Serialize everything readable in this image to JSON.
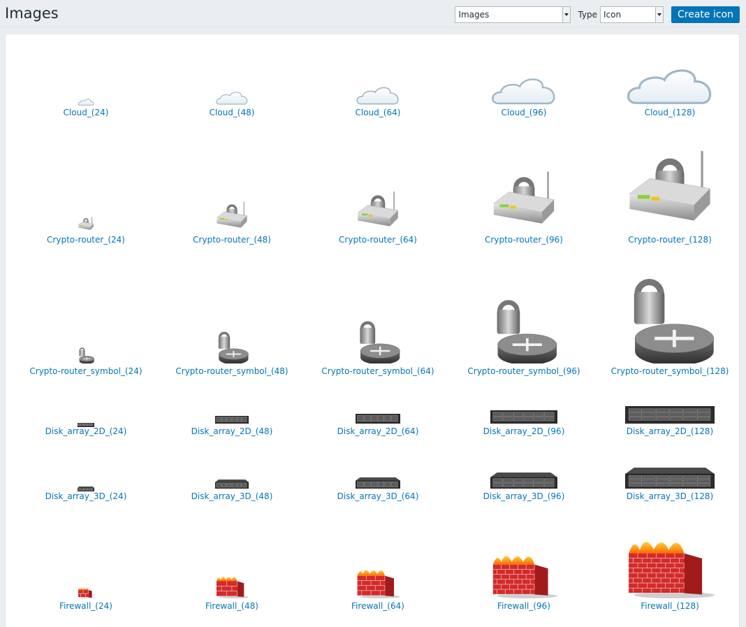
{
  "header": {
    "title": "Images",
    "images_select": "Images",
    "type_label": "Type",
    "type_select": "Icon",
    "create_button": "Create icon"
  },
  "rows": [
    {
      "kind": "cloud",
      "items": [
        "Cloud_(24)",
        "Cloud_(48)",
        "Cloud_(64)",
        "Cloud_(96)",
        "Cloud_(128)"
      ]
    },
    {
      "kind": "crypto-router",
      "items": [
        "Crypto-router_(24)",
        "Crypto-router_(48)",
        "Crypto-router_(64)",
        "Crypto-router_(96)",
        "Crypto-router_(128)"
      ]
    },
    {
      "kind": "crypto-router-symbol",
      "items": [
        "Crypto-router_symbol_(24)",
        "Crypto-router_symbol_(48)",
        "Crypto-router_symbol_(64)",
        "Crypto-router_symbol_(96)",
        "Crypto-router_symbol_(128)"
      ]
    },
    {
      "kind": "disk-array-2d",
      "items": [
        "Disk_array_2D_(24)",
        "Disk_array_2D_(48)",
        "Disk_array_2D_(64)",
        "Disk_array_2D_(96)",
        "Disk_array_2D_(128)"
      ]
    },
    {
      "kind": "disk-array-3d",
      "items": [
        "Disk_array_3D_(24)",
        "Disk_array_3D_(48)",
        "Disk_array_3D_(64)",
        "Disk_array_3D_(96)",
        "Disk_array_3D_(128)"
      ]
    },
    {
      "kind": "firewall",
      "items": [
        "Firewall_(24)",
        "Firewall_(48)",
        "Firewall_(64)",
        "Firewall_(96)",
        "Firewall_(128)"
      ]
    }
  ]
}
